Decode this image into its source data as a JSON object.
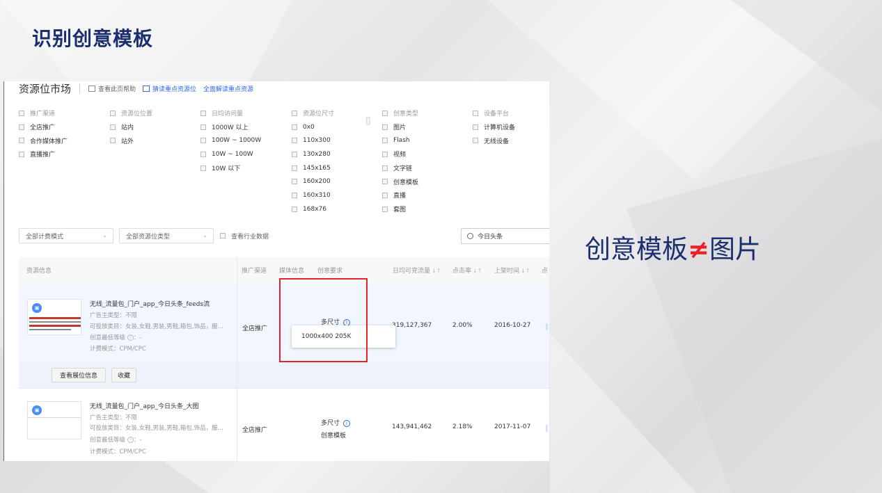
{
  "slide": {
    "title": "识别创意模板",
    "note_left": "创意模板",
    "note_symbol": "≠",
    "note_right": "图片"
  },
  "colors": {
    "title": "#1b2e6e",
    "accent_red": "#e8202a",
    "link_blue": "#2d6ae3",
    "row_highlight": "#f2f7ff"
  },
  "header": {
    "title": "资源位市场",
    "links": [
      {
        "label": "查看此页帮助",
        "icon": "help-doc-icon"
      },
      {
        "label": "猜读重点资源位",
        "icon": "mail-icon"
      },
      {
        "label": "全面解读重点资源"
      }
    ]
  },
  "filters": [
    {
      "name": "推广渠道",
      "options": [
        "全店推广",
        "合作媒体推广",
        "直播推广"
      ]
    },
    {
      "name": "资源位位置",
      "options": [
        "站内",
        "站外"
      ]
    },
    {
      "name": "日均访问量",
      "options": [
        "1000W 以上",
        "100W ~ 1000W",
        "10W ~ 100W",
        "10W 以下"
      ]
    },
    {
      "name": "资源位尺寸",
      "options": [
        "0x0",
        "110x300",
        "130x280",
        "145x165",
        "160x200",
        "160x310",
        "168x76"
      ]
    },
    {
      "name": "创意类型",
      "options": [
        "图片",
        "Flash",
        "视频",
        "文字链",
        "创意模板",
        "直播",
        "套图"
      ]
    },
    {
      "name": "设备平台",
      "options": [
        "计算机设备",
        "无线设备"
      ]
    }
  ],
  "toolbar": {
    "billing_select": "全部计费模式",
    "type_select": "全部资源位类型",
    "industry_checkbox": "查看行业数据",
    "search_value": "今日头条"
  },
  "table": {
    "columns": [
      "资源信息",
      "推广渠道",
      "媒体信息",
      "创意要求",
      "日均可竞流量",
      "点击率",
      "上架时间",
      "点"
    ],
    "rows": [
      {
        "name": "无线_流量包_门户_app_今日头条_feeds流",
        "advertiser": "广告主类型：不限",
        "categories": "可投放类目：女装,女鞋,男装,男鞋,箱包,饰品，服…",
        "level_label": "创意最低等级",
        "level_value": "：-",
        "billing": "计费模式：CPM/CPC",
        "channel": "全店推广",
        "creative": "多尺寸",
        "creative_sub": "",
        "traffic": "319,127,367",
        "ctr": "2.00%",
        "date": "2016-10-27"
      },
      {
        "name": "无线_流量包_门户_app_今日头条_大图",
        "advertiser": "广告主类型：不限",
        "categories": "可投放类目：女装,女鞋,男装,男鞋,箱包,饰品，服…",
        "level_label": "创意最低等级",
        "level_value": "：-",
        "billing": "计费模式：CPM/CPC",
        "channel": "全店推广",
        "creative": "多尺寸",
        "creative_sub": "创意模板",
        "traffic": "143,941,462",
        "ctr": "2.18%",
        "date": "2017-11-07"
      }
    ],
    "row_actions": [
      "查看展位信息",
      "收藏"
    ],
    "tooltip": "1000x400  205K"
  }
}
